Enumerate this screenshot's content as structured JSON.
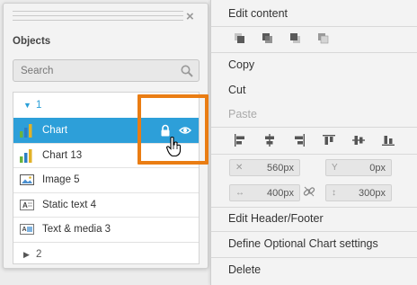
{
  "objects_panel": {
    "title": "Objects",
    "close_glyph": "×",
    "search": {
      "placeholder": "Search",
      "value": "",
      "icon": "search-icon"
    },
    "groups": [
      {
        "label": "1",
        "expanded": true,
        "items": [
          {
            "label": "Chart",
            "icon": "bar-chart-icon",
            "selected": true,
            "actions": [
              "lock-icon",
              "eye-icon"
            ]
          },
          {
            "label": "Chart 13",
            "icon": "bar-chart-icon"
          },
          {
            "label": "Image 5",
            "icon": "image-icon"
          },
          {
            "label": "Static text 4",
            "icon": "text-icon"
          },
          {
            "label": "Text & media 3",
            "icon": "text-media-icon"
          }
        ]
      },
      {
        "label": "2",
        "expanded": false,
        "items": []
      }
    ]
  },
  "context_menu": {
    "edit_content": "Edit content",
    "layer_buttons": [
      "bring-to-front-icon",
      "bring-forward-icon",
      "send-backward-icon",
      "send-to-back-icon"
    ],
    "copy": "Copy",
    "cut": "Cut",
    "paste": "Paste",
    "paste_disabled": true,
    "align_buttons": [
      "align-left-icon",
      "align-center-icon",
      "align-right-icon",
      "align-top-icon",
      "align-middle-icon",
      "align-bottom-icon"
    ],
    "x_value": "560px",
    "y_value": "0px",
    "width_value": "400px",
    "height_value": "300px",
    "field_icons": [
      "x-axis-icon",
      "y-axis-icon",
      "width-icon",
      "height-icon",
      "link-icon"
    ],
    "edit_header_footer": "Edit Header/Footer",
    "define_chart_settings": "Define Optional Chart settings",
    "delete": "Delete"
  },
  "colors": {
    "selection": "#2d9fd9",
    "highlight": "#ea7d13",
    "expanded_group": "#2a9fd8",
    "chart_icon_green": "#6ab43e",
    "chart_icon_blue": "#2d7ec4",
    "chart_icon_yellow": "#e2b227"
  }
}
